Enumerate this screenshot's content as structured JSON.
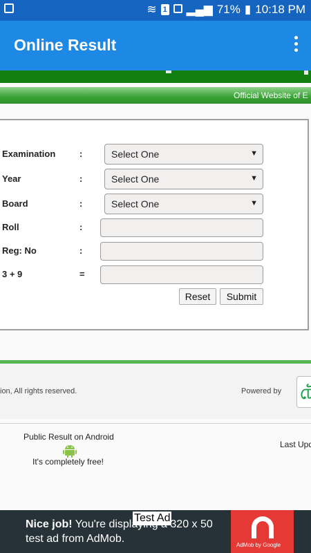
{
  "status_bar": {
    "battery": "71%",
    "time": "10:18 PM",
    "sim_label": "1"
  },
  "app_bar": {
    "title": "Online Result",
    "menu_icon": "more-vertical-icon"
  },
  "ticker": {
    "text": "Official Website of E"
  },
  "form": {
    "fields": [
      {
        "label": "Examination",
        "sep": ":",
        "type": "select",
        "value": "Select One"
      },
      {
        "label": "Year",
        "sep": ":",
        "type": "select",
        "value": "Select One"
      },
      {
        "label": "Board",
        "sep": ":",
        "type": "select",
        "value": "Select One"
      },
      {
        "label": "Roll",
        "sep": ":",
        "type": "input",
        "value": ""
      },
      {
        "label": "Reg: No",
        "sep": ":",
        "type": "input",
        "value": ""
      },
      {
        "label": "3 + 9",
        "sep": "=",
        "type": "input",
        "value": ""
      }
    ],
    "reset_label": "Reset",
    "submit_label": "Submit"
  },
  "footer": {
    "copyright": "ion, All rights reserved.",
    "powered_by": "Powered by",
    "logo_text": "টে"
  },
  "android": {
    "title": "Public Result on Android",
    "subtitle": "It's completely free!",
    "last_update": "Last Upd"
  },
  "ad": {
    "bold": "Nice job!",
    "rest": " You're displaying a 320 x 50 test ad from AdMob.",
    "badge": "Test Ad",
    "byline": "AdMob by Google"
  },
  "colors": {
    "status_bar": "#1565c0",
    "app_bar": "#1e88e5",
    "green_band": "#11800f",
    "ad_red": "#e53935"
  }
}
